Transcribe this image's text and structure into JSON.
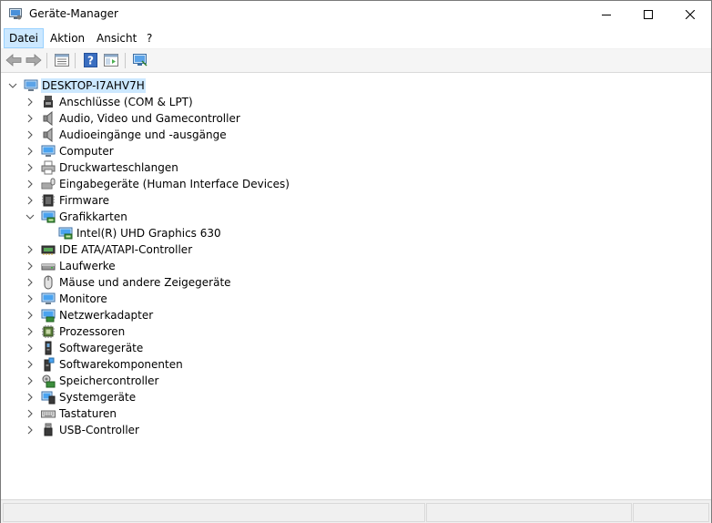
{
  "window": {
    "title": "Geräte-Manager"
  },
  "menu": [
    {
      "label": "Datei",
      "active": true
    },
    {
      "label": "Aktion",
      "active": false
    },
    {
      "label": "Ansicht",
      "active": false
    },
    {
      "label": "?",
      "active": false
    }
  ],
  "toolbar": {
    "icons": [
      "back-arrow-icon",
      "forward-arrow-icon",
      "properties-icon",
      "help-icon",
      "console-tree-icon",
      "scan-hardware-icon"
    ]
  },
  "tree": {
    "root": {
      "label": "DESKTOP-I7AHV7H",
      "icon": "computer-icon",
      "expanded": true,
      "selected": true
    },
    "categories": [
      {
        "label": "Anschlüsse (COM & LPT)",
        "icon": "port-icon",
        "expanded": false
      },
      {
        "label": "Audio, Video und Gamecontroller",
        "icon": "speaker-icon",
        "expanded": false
      },
      {
        "label": "Audioeingänge und -ausgänge",
        "icon": "speaker-icon",
        "expanded": false
      },
      {
        "label": "Computer",
        "icon": "monitor-icon",
        "expanded": false
      },
      {
        "label": "Druckwarteschlangen",
        "icon": "printer-icon",
        "expanded": false
      },
      {
        "label": "Eingabegeräte (Human Interface Devices)",
        "icon": "keyboard-mouse-icon",
        "expanded": false
      },
      {
        "label": "Firmware",
        "icon": "chip-icon",
        "expanded": false
      },
      {
        "label": "Grafikkarten",
        "icon": "display-adapter-icon",
        "expanded": true,
        "children": [
          {
            "label": "Intel(R) UHD Graphics 630",
            "icon": "display-adapter-icon"
          }
        ]
      },
      {
        "label": "IDE ATA/ATAPI-Controller",
        "icon": "ide-controller-icon",
        "expanded": false
      },
      {
        "label": "Laufwerke",
        "icon": "disk-drive-icon",
        "expanded": false
      },
      {
        "label": "Mäuse und andere Zeigegeräte",
        "icon": "mouse-icon",
        "expanded": false
      },
      {
        "label": "Monitore",
        "icon": "monitor-icon",
        "expanded": false
      },
      {
        "label": "Netzwerkadapter",
        "icon": "network-adapter-icon",
        "expanded": false
      },
      {
        "label": "Prozessoren",
        "icon": "processor-icon",
        "expanded": false
      },
      {
        "label": "Softwaregeräte",
        "icon": "software-device-icon",
        "expanded": false
      },
      {
        "label": "Softwarekomponenten",
        "icon": "software-component-icon",
        "expanded": false
      },
      {
        "label": "Speichercontroller",
        "icon": "storage-controller-icon",
        "expanded": false
      },
      {
        "label": "Systemgeräte",
        "icon": "system-devices-icon",
        "expanded": false
      },
      {
        "label": "Tastaturen",
        "icon": "keyboard-icon",
        "expanded": false
      },
      {
        "label": "USB-Controller",
        "icon": "usb-icon",
        "expanded": false
      }
    ]
  },
  "colors": {
    "selection": "#cce8ff",
    "selection_border": "#99d1ff",
    "toolbar_bg": "#f5f5f5",
    "status_bg": "#f0f0f0"
  }
}
